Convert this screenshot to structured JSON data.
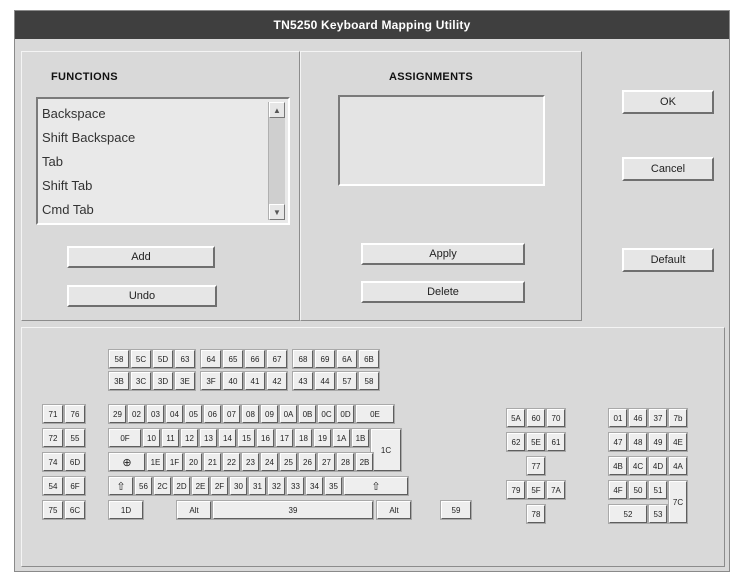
{
  "window": {
    "title": "TN5250 Keyboard Mapping Utility"
  },
  "functions": {
    "heading": "FUNCTIONS",
    "items": [
      "Backspace",
      "Shift Backspace",
      "Tab",
      "Shift Tab",
      "Cmd Tab"
    ],
    "add_label": "Add",
    "undo_label": "Undo"
  },
  "assignments": {
    "heading": "ASSIGNMENTS",
    "value": "",
    "apply_label": "Apply",
    "delete_label": "Delete"
  },
  "dialog": {
    "ok_label": "OK",
    "cancel_label": "Cancel",
    "default_label": "Default"
  },
  "keyboard": {
    "fn_top": [
      "58",
      "5C",
      "5D",
      "63",
      "64",
      "65",
      "66",
      "67",
      "68",
      "69",
      "6A",
      "6B"
    ],
    "fn_bottom": [
      "3B",
      "3C",
      "3D",
      "3E",
      "3F",
      "40",
      "41",
      "42",
      "43",
      "44",
      "57",
      "58"
    ],
    "left": [
      "71",
      "76",
      "72",
      "55",
      "74",
      "6D",
      "54",
      "6F",
      "75",
      "6C"
    ],
    "row1": [
      "29",
      "02",
      "03",
      "04",
      "05",
      "06",
      "07",
      "08",
      "09",
      "0A",
      "0B",
      "0C",
      "0D",
      "0E"
    ],
    "row2": [
      "0F",
      "10",
      "11",
      "12",
      "13",
      "14",
      "15",
      "16",
      "17",
      "18",
      "19",
      "1A",
      "1B"
    ],
    "enter": "1C",
    "row3": [
      "1E",
      "1F",
      "20",
      "21",
      "22",
      "23",
      "24",
      "25",
      "26",
      "27",
      "28",
      "2B"
    ],
    "row4": [
      "56",
      "2C",
      "2D",
      "2E",
      "2F",
      "30",
      "31",
      "32",
      "33",
      "34",
      "35"
    ],
    "row5": [
      "1D",
      "Alt",
      "39",
      "Alt",
      "59"
    ],
    "cursor": [
      "5A",
      "60",
      "70",
      "62",
      "5E",
      "61",
      "77",
      "79",
      "5F",
      "7A",
      "78"
    ],
    "numpad": [
      "01",
      "46",
      "37",
      "7b",
      "47",
      "48",
      "49",
      "4E",
      "4B",
      "4C",
      "4D",
      "4A",
      "4F",
      "50",
      "51",
      "7C",
      "52",
      "53"
    ]
  }
}
